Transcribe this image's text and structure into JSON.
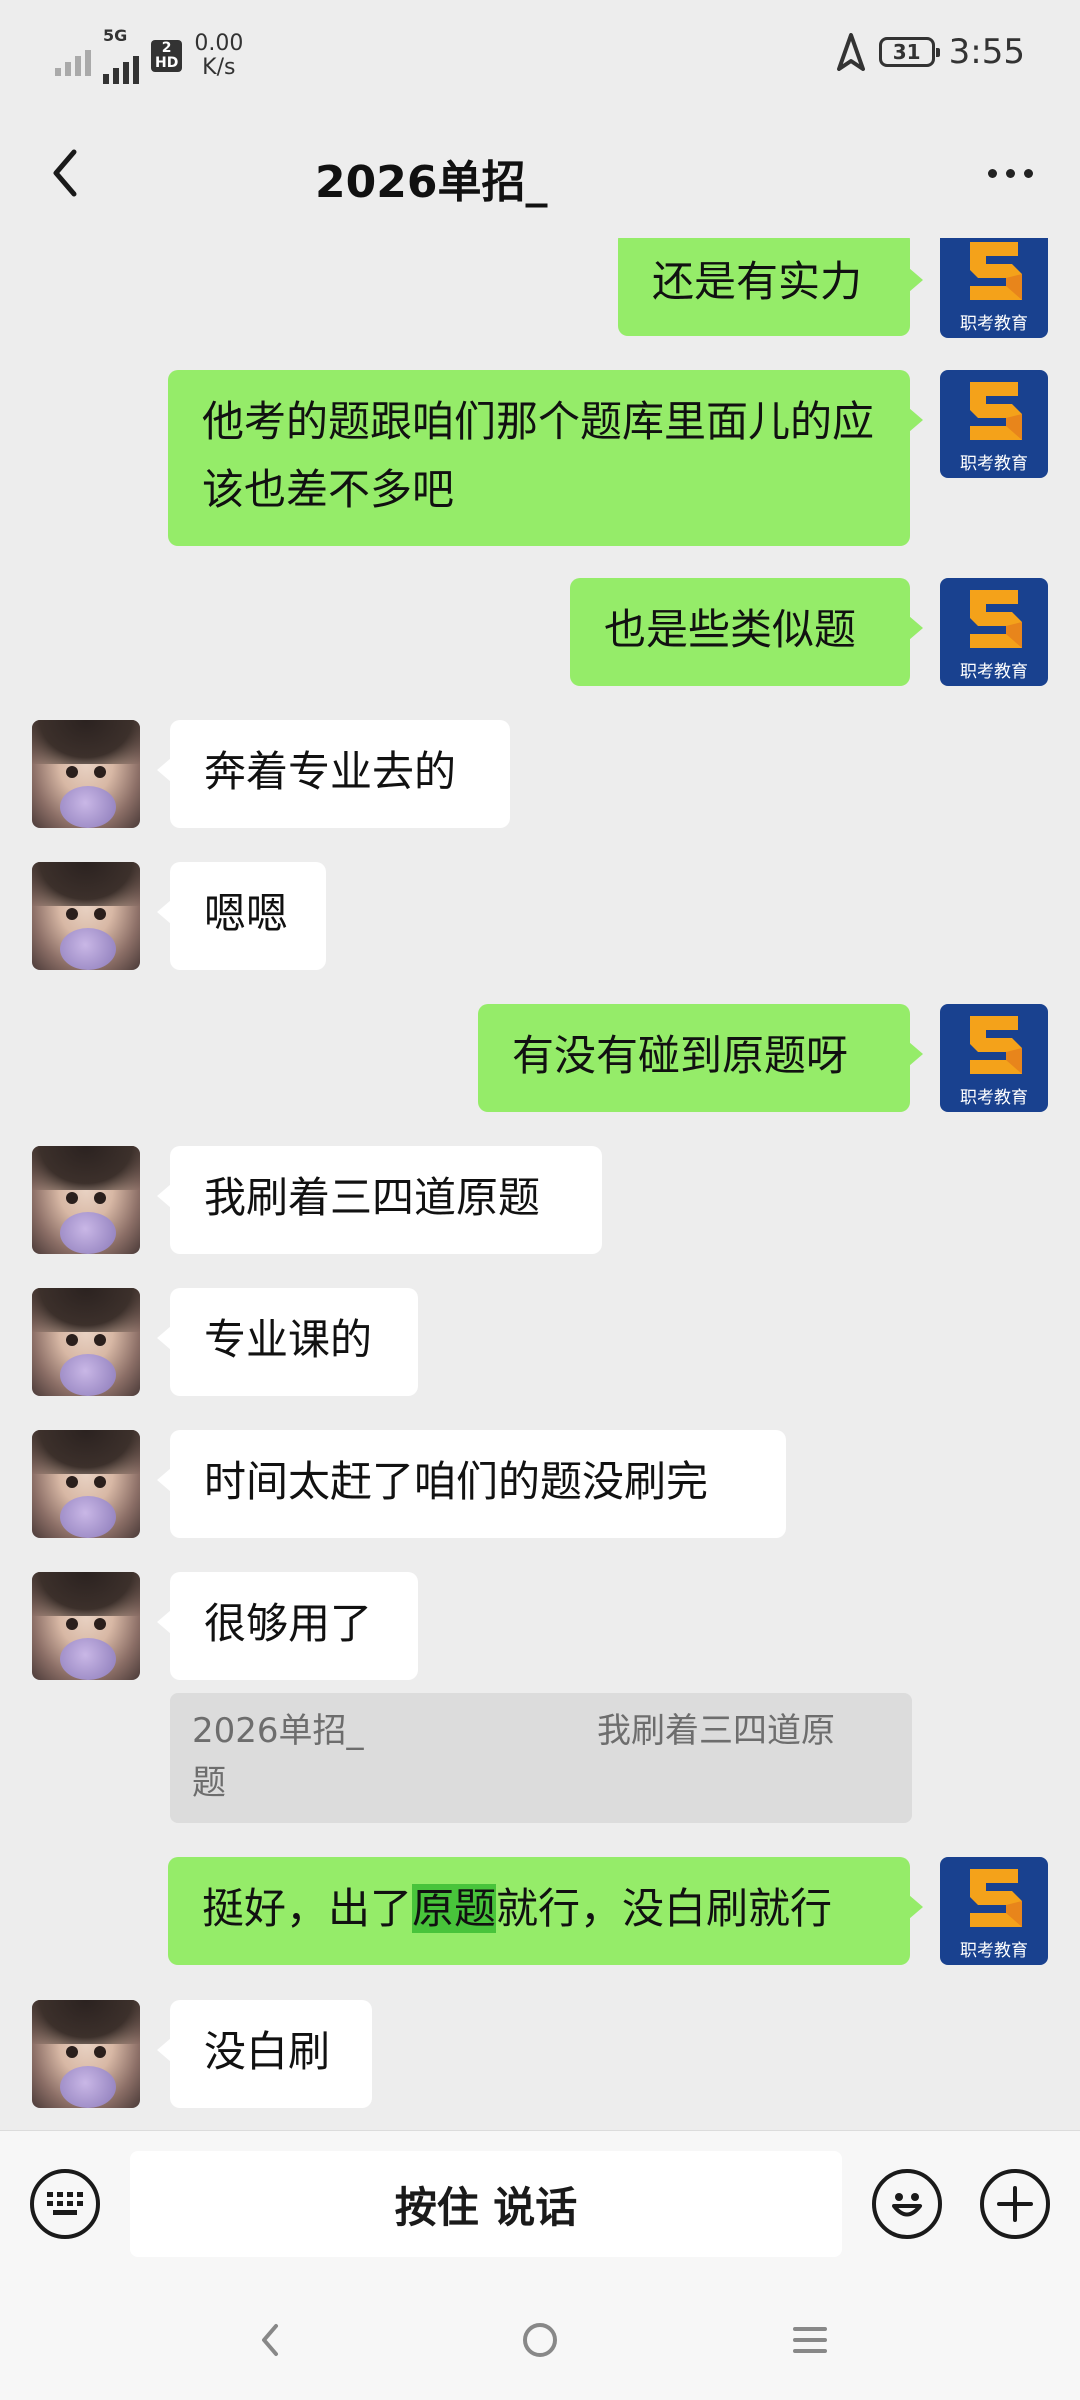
{
  "status_bar": {
    "net_tag": "5G",
    "hd_top": "2",
    "hd_bottom": "HD",
    "speed_value": "0.00",
    "speed_unit": "K/s",
    "battery": "31",
    "time": "3:55"
  },
  "header": {
    "title": "2026单招_"
  },
  "my_avatar": {
    "text": "职考教育"
  },
  "messages": [
    {
      "sender": "me",
      "text": "还是有实力"
    },
    {
      "sender": "me",
      "text": "他考的题跟咱们那个题库里面儿的应该也差不多吧"
    },
    {
      "sender": "me",
      "text": "也是些类似题"
    },
    {
      "sender": "other",
      "text": "奔着专业去的"
    },
    {
      "sender": "other",
      "text": "嗯嗯"
    },
    {
      "sender": "me",
      "text": "有没有碰到原题呀"
    },
    {
      "sender": "other",
      "text": "我刷着三四道原题"
    },
    {
      "sender": "other",
      "text": "专业课的"
    },
    {
      "sender": "other",
      "text": "时间太赶了咱们的题没刷完"
    },
    {
      "sender": "other",
      "text": "很够用了"
    },
    {
      "sender": "me",
      "text_before": "挺好，出了",
      "text_highlight": "原题",
      "text_after": "就行，没白刷就行",
      "quote": {
        "name": "2026单招_",
        "text_line1": "我刷着三四道原",
        "text_line2": "题"
      }
    },
    {
      "sender": "other",
      "text": "没白刷"
    }
  ],
  "input_bar": {
    "voice_label": "按住 说话"
  },
  "colors": {
    "my_bubble": "#95ec69",
    "other_bubble": "#ffffff",
    "background": "#ededed",
    "avatar_brand": "#19418f"
  },
  "icons": [
    "back-icon",
    "more-icon",
    "keyboard-icon",
    "emoji-icon",
    "plus-icon",
    "nav-back-icon",
    "nav-home-icon",
    "nav-menu-icon"
  ]
}
